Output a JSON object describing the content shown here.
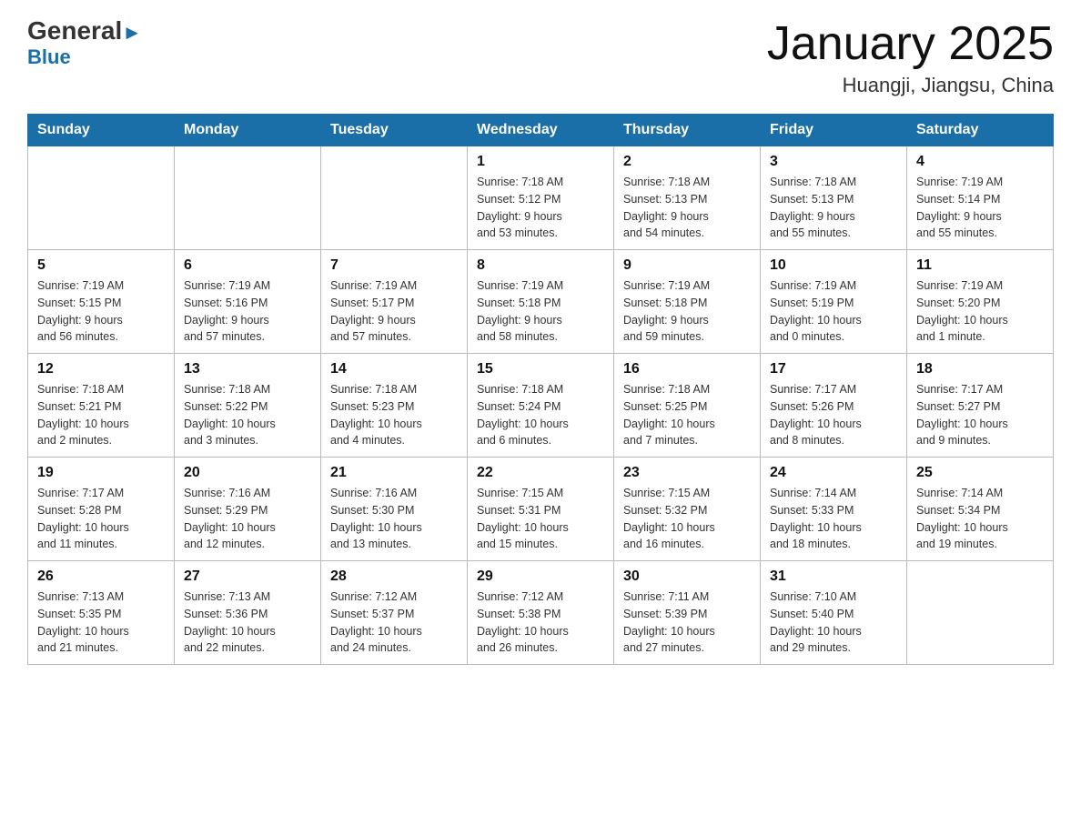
{
  "header": {
    "logo_general": "General",
    "logo_blue": "Blue",
    "month_title": "January 2025",
    "location": "Huangji, Jiangsu, China"
  },
  "weekdays": [
    "Sunday",
    "Monday",
    "Tuesday",
    "Wednesday",
    "Thursday",
    "Friday",
    "Saturday"
  ],
  "weeks": [
    [
      {
        "day": "",
        "info": ""
      },
      {
        "day": "",
        "info": ""
      },
      {
        "day": "",
        "info": ""
      },
      {
        "day": "1",
        "info": "Sunrise: 7:18 AM\nSunset: 5:12 PM\nDaylight: 9 hours\nand 53 minutes."
      },
      {
        "day": "2",
        "info": "Sunrise: 7:18 AM\nSunset: 5:13 PM\nDaylight: 9 hours\nand 54 minutes."
      },
      {
        "day": "3",
        "info": "Sunrise: 7:18 AM\nSunset: 5:13 PM\nDaylight: 9 hours\nand 55 minutes."
      },
      {
        "day": "4",
        "info": "Sunrise: 7:19 AM\nSunset: 5:14 PM\nDaylight: 9 hours\nand 55 minutes."
      }
    ],
    [
      {
        "day": "5",
        "info": "Sunrise: 7:19 AM\nSunset: 5:15 PM\nDaylight: 9 hours\nand 56 minutes."
      },
      {
        "day": "6",
        "info": "Sunrise: 7:19 AM\nSunset: 5:16 PM\nDaylight: 9 hours\nand 57 minutes."
      },
      {
        "day": "7",
        "info": "Sunrise: 7:19 AM\nSunset: 5:17 PM\nDaylight: 9 hours\nand 57 minutes."
      },
      {
        "day": "8",
        "info": "Sunrise: 7:19 AM\nSunset: 5:18 PM\nDaylight: 9 hours\nand 58 minutes."
      },
      {
        "day": "9",
        "info": "Sunrise: 7:19 AM\nSunset: 5:18 PM\nDaylight: 9 hours\nand 59 minutes."
      },
      {
        "day": "10",
        "info": "Sunrise: 7:19 AM\nSunset: 5:19 PM\nDaylight: 10 hours\nand 0 minutes."
      },
      {
        "day": "11",
        "info": "Sunrise: 7:19 AM\nSunset: 5:20 PM\nDaylight: 10 hours\nand 1 minute."
      }
    ],
    [
      {
        "day": "12",
        "info": "Sunrise: 7:18 AM\nSunset: 5:21 PM\nDaylight: 10 hours\nand 2 minutes."
      },
      {
        "day": "13",
        "info": "Sunrise: 7:18 AM\nSunset: 5:22 PM\nDaylight: 10 hours\nand 3 minutes."
      },
      {
        "day": "14",
        "info": "Sunrise: 7:18 AM\nSunset: 5:23 PM\nDaylight: 10 hours\nand 4 minutes."
      },
      {
        "day": "15",
        "info": "Sunrise: 7:18 AM\nSunset: 5:24 PM\nDaylight: 10 hours\nand 6 minutes."
      },
      {
        "day": "16",
        "info": "Sunrise: 7:18 AM\nSunset: 5:25 PM\nDaylight: 10 hours\nand 7 minutes."
      },
      {
        "day": "17",
        "info": "Sunrise: 7:17 AM\nSunset: 5:26 PM\nDaylight: 10 hours\nand 8 minutes."
      },
      {
        "day": "18",
        "info": "Sunrise: 7:17 AM\nSunset: 5:27 PM\nDaylight: 10 hours\nand 9 minutes."
      }
    ],
    [
      {
        "day": "19",
        "info": "Sunrise: 7:17 AM\nSunset: 5:28 PM\nDaylight: 10 hours\nand 11 minutes."
      },
      {
        "day": "20",
        "info": "Sunrise: 7:16 AM\nSunset: 5:29 PM\nDaylight: 10 hours\nand 12 minutes."
      },
      {
        "day": "21",
        "info": "Sunrise: 7:16 AM\nSunset: 5:30 PM\nDaylight: 10 hours\nand 13 minutes."
      },
      {
        "day": "22",
        "info": "Sunrise: 7:15 AM\nSunset: 5:31 PM\nDaylight: 10 hours\nand 15 minutes."
      },
      {
        "day": "23",
        "info": "Sunrise: 7:15 AM\nSunset: 5:32 PM\nDaylight: 10 hours\nand 16 minutes."
      },
      {
        "day": "24",
        "info": "Sunrise: 7:14 AM\nSunset: 5:33 PM\nDaylight: 10 hours\nand 18 minutes."
      },
      {
        "day": "25",
        "info": "Sunrise: 7:14 AM\nSunset: 5:34 PM\nDaylight: 10 hours\nand 19 minutes."
      }
    ],
    [
      {
        "day": "26",
        "info": "Sunrise: 7:13 AM\nSunset: 5:35 PM\nDaylight: 10 hours\nand 21 minutes."
      },
      {
        "day": "27",
        "info": "Sunrise: 7:13 AM\nSunset: 5:36 PM\nDaylight: 10 hours\nand 22 minutes."
      },
      {
        "day": "28",
        "info": "Sunrise: 7:12 AM\nSunset: 5:37 PM\nDaylight: 10 hours\nand 24 minutes."
      },
      {
        "day": "29",
        "info": "Sunrise: 7:12 AM\nSunset: 5:38 PM\nDaylight: 10 hours\nand 26 minutes."
      },
      {
        "day": "30",
        "info": "Sunrise: 7:11 AM\nSunset: 5:39 PM\nDaylight: 10 hours\nand 27 minutes."
      },
      {
        "day": "31",
        "info": "Sunrise: 7:10 AM\nSunset: 5:40 PM\nDaylight: 10 hours\nand 29 minutes."
      },
      {
        "day": "",
        "info": ""
      }
    ]
  ]
}
